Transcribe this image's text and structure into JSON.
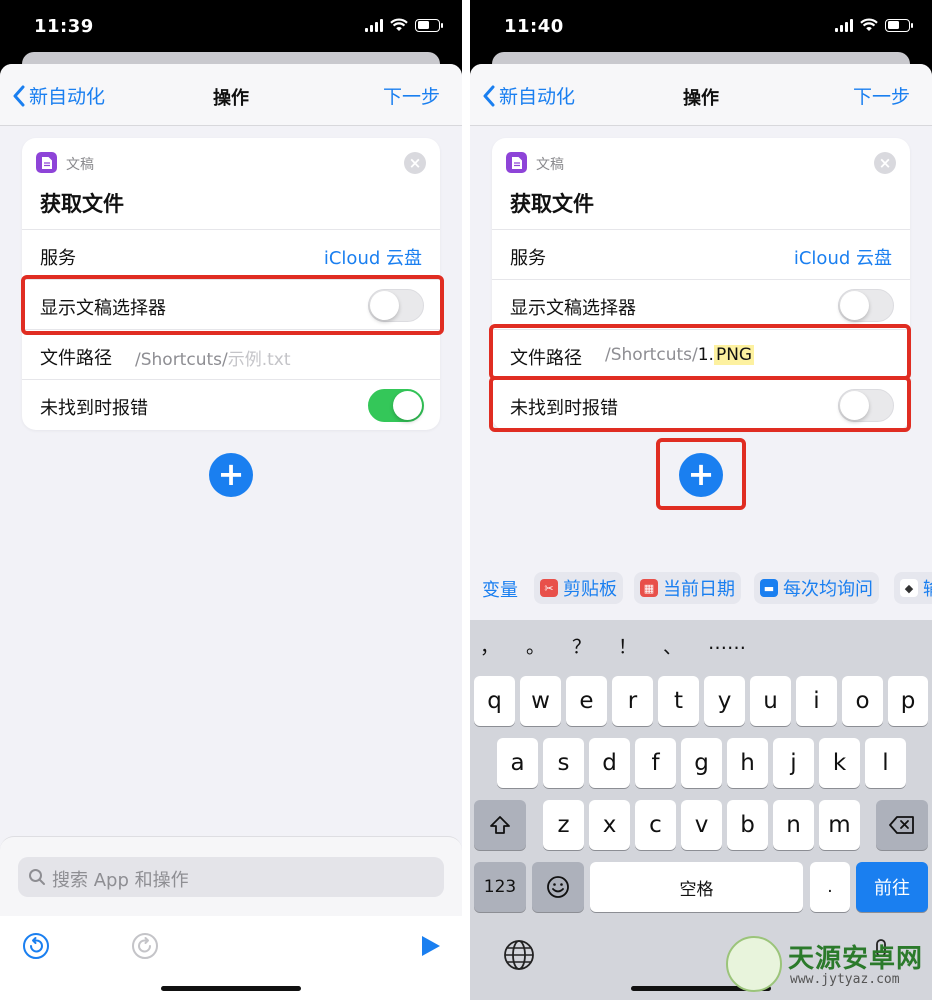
{
  "left": {
    "status_time": "11:39",
    "nav": {
      "back_label": "新自动化",
      "title": "操作",
      "next_label": "下一步"
    },
    "card": {
      "app_name": "文稿",
      "action_title": "获取文件",
      "rows": [
        {
          "label": "服务",
          "value": "iCloud 云盘"
        },
        {
          "label": "显示文稿选择器",
          "toggle": "off"
        },
        {
          "label": "文件路径",
          "path_prefix": "/Shortcuts/",
          "path_placeholder": "示例.txt"
        },
        {
          "label": "未找到时报错",
          "toggle": "on"
        }
      ]
    },
    "search_placeholder": "搜索 App 和操作",
    "toolbar": [
      "undo-icon",
      "redo-icon",
      "play-icon"
    ]
  },
  "right": {
    "status_time": "11:40",
    "nav": {
      "back_label": "新自动化",
      "title": "操作",
      "next_label": "下一步"
    },
    "card": {
      "app_name": "文稿",
      "action_title": "获取文件",
      "rows": [
        {
          "label": "服务",
          "value": "iCloud 云盘"
        },
        {
          "label": "显示文稿选择器",
          "toggle": "off"
        },
        {
          "label": "文件路径",
          "path_prefix": "/Shortcuts/",
          "path_typed": "1.",
          "path_highlight": "PNG"
        },
        {
          "label": "未找到时报错",
          "toggle": "off"
        }
      ]
    },
    "suggestions": {
      "label": "变量",
      "chips": [
        {
          "label": "剪贴板",
          "icon": "scissors-icon",
          "color": "#e8504a"
        },
        {
          "label": "当前日期",
          "icon": "calendar-icon",
          "color": "#e8504a"
        },
        {
          "label": "每次均询问",
          "icon": "chat-icon",
          "color": "#1a7ff0"
        },
        {
          "label": "输",
          "icon": "layers-icon",
          "color": "#555555"
        }
      ]
    },
    "keyboard": {
      "punctuation": [
        "，",
        "。",
        "？",
        "！",
        "、",
        "……"
      ],
      "row1": [
        "q",
        "w",
        "e",
        "r",
        "t",
        "y",
        "u",
        "i",
        "o",
        "p"
      ],
      "row2": [
        "a",
        "s",
        "d",
        "f",
        "g",
        "h",
        "j",
        "k",
        "l"
      ],
      "row3": [
        "z",
        "x",
        "c",
        "v",
        "b",
        "n",
        "m"
      ],
      "numbers_key": "123",
      "space_key": "空格",
      "period_key": ".",
      "return_key": "前往"
    }
  },
  "watermark": {
    "title": "天源安卓网",
    "url": "www.jytyaz.com"
  },
  "colors": {
    "accent": "#1a7ff0",
    "highlight_box": "#e02d22",
    "toggle_on": "#34c759"
  }
}
